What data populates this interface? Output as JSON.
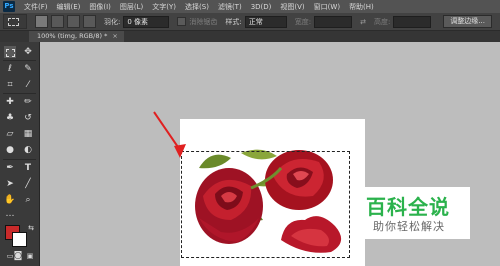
{
  "app": {
    "logo": "Ps"
  },
  "menu": [
    "文件(F)",
    "编辑(E)",
    "图像(I)",
    "图层(L)",
    "文字(Y)",
    "选择(S)",
    "滤镜(T)",
    "3D(D)",
    "视图(V)",
    "窗口(W)",
    "帮助(H)"
  ],
  "options": {
    "feather_label": "羽化:",
    "feather_value": "0 像素",
    "antialias_label": "消除锯齿",
    "style_label": "样式:",
    "style_value": "正常",
    "width_label": "宽度:",
    "height_label": "高度:",
    "refine_button": "调整边缘..."
  },
  "document": {
    "tab_title": "100% (timg, RGB/8) *",
    "close": "×"
  },
  "colors": {
    "foreground": "#c82a2a",
    "background": "#ffffff"
  },
  "watermark": {
    "title": "百科全说",
    "subtitle": "助你轻松解决"
  }
}
